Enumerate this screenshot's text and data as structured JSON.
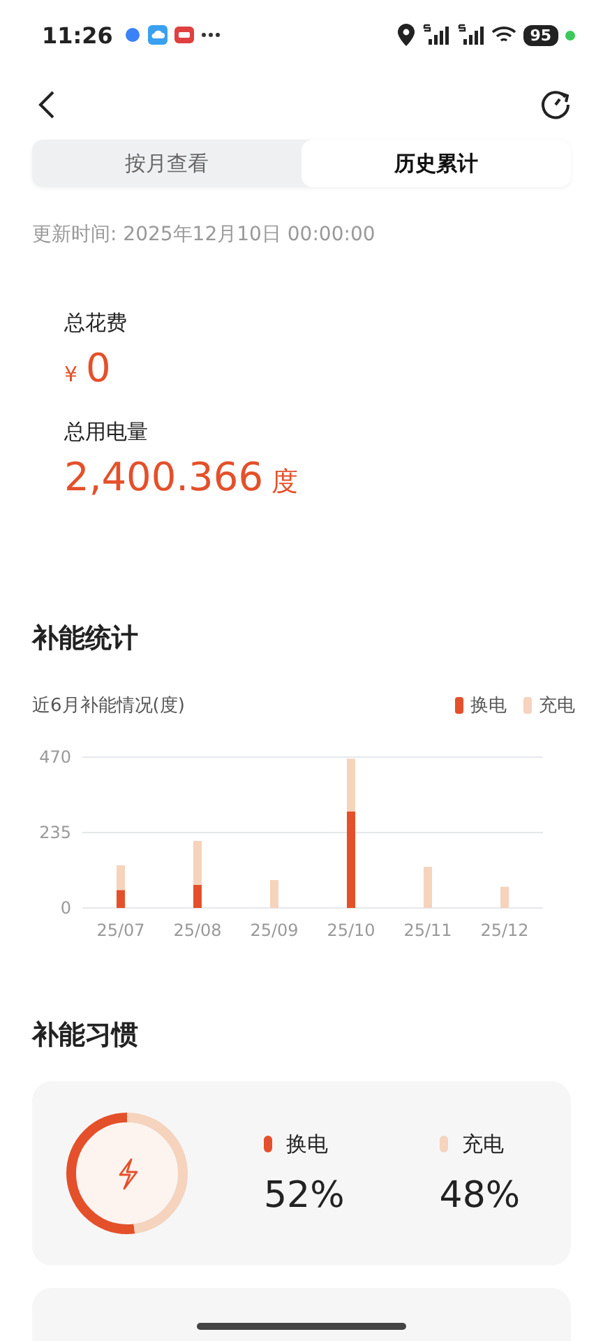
{
  "status_bar": {
    "time": "11:26",
    "battery": "95"
  },
  "tabs": [
    {
      "label": "按月查看",
      "selected": false
    },
    {
      "label": "历史累计",
      "selected": true
    }
  ],
  "update_time": "更新时间: 2025年12月10日 00:00:00",
  "summary": {
    "cost_label": "总花费",
    "currency": "¥",
    "cost": "0",
    "energy_label": "总用电量",
    "energy": "2,400.366",
    "energy_unit": "度"
  },
  "stats": {
    "title": "补能统计",
    "chart_data": {
      "type": "bar",
      "stacked": true,
      "title": "近6月补能情况(度)",
      "categories": [
        "25/07",
        "25/08",
        "25/09",
        "25/10",
        "25/11",
        "25/12"
      ],
      "ylim": [
        0,
        470
      ],
      "yticks": [
        0,
        235,
        470
      ],
      "series": [
        {
          "name": "换电",
          "color": "#e4502a",
          "values": [
            56,
            72,
            0,
            301,
            0,
            0
          ]
        },
        {
          "name": "充电",
          "color": "#f5d3bd",
          "values": [
            77,
            137,
            87,
            164,
            128,
            66
          ]
        }
      ]
    }
  },
  "habit": {
    "title": "补能习惯",
    "items": [
      {
        "name": "换电",
        "value": "52%",
        "color": "#e4502a",
        "level": 0.52
      },
      {
        "name": "充电",
        "value": "48%",
        "color": "#f5d3bd",
        "level": 0.48
      }
    ]
  }
}
